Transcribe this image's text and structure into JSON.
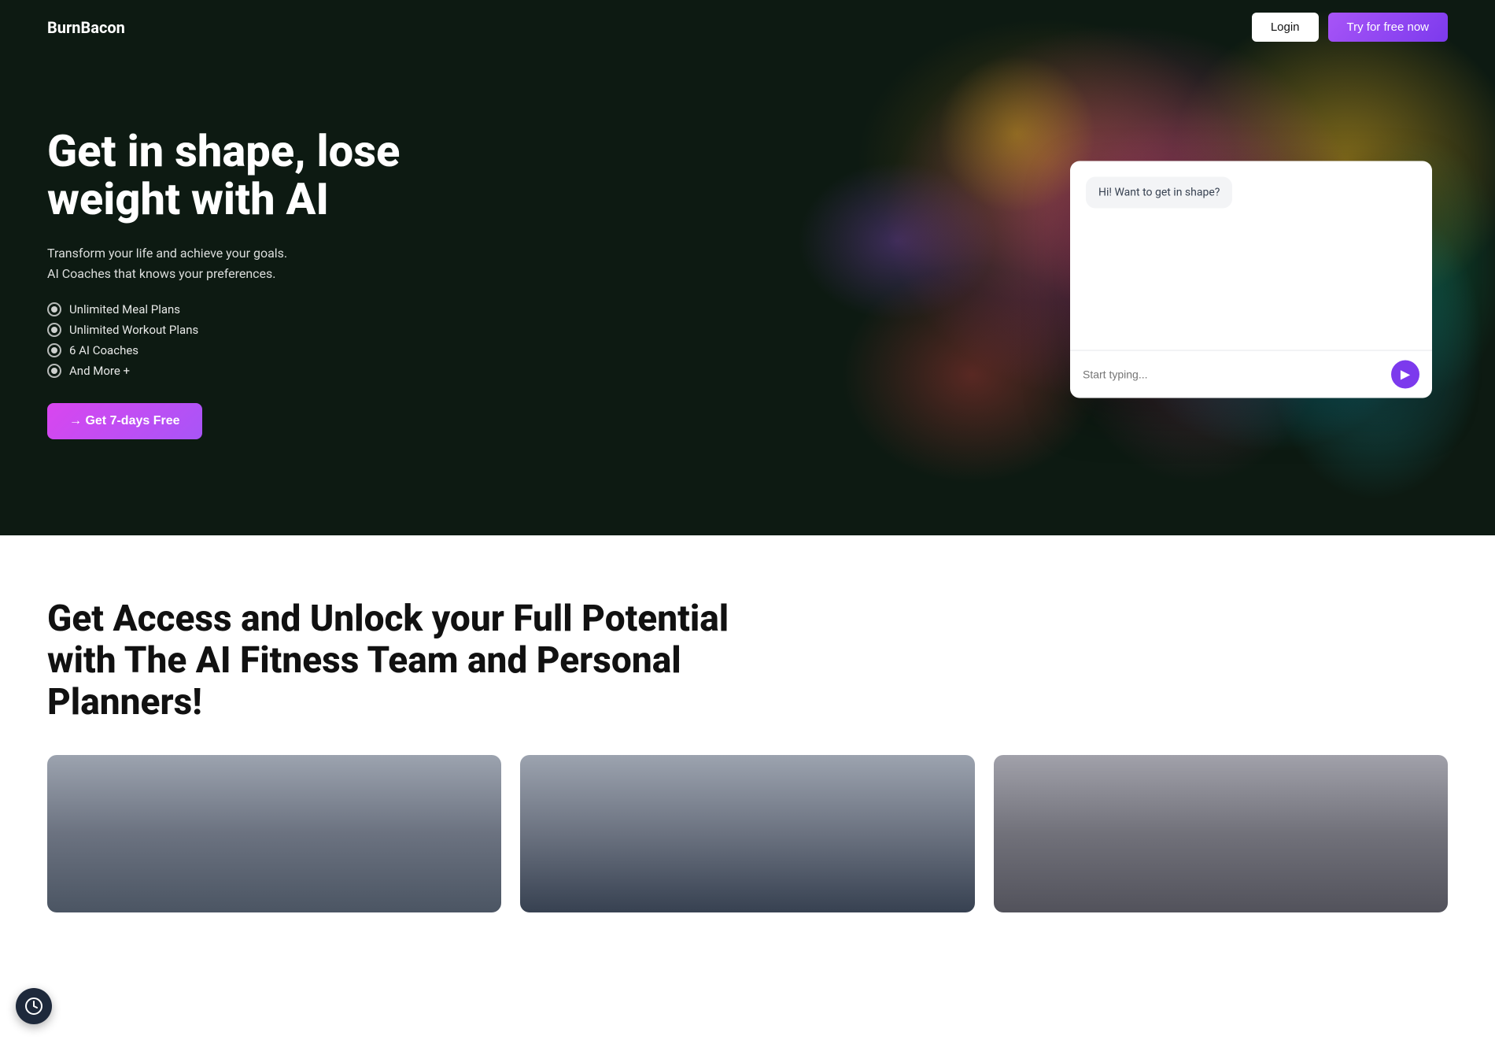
{
  "brand": {
    "name_part1": "Burn",
    "name_part2": "Bacon"
  },
  "navbar": {
    "login_label": "Login",
    "try_label": "Try for free now"
  },
  "hero": {
    "title": "Get in shape, lose weight with AI",
    "subtitle_line1": "Transform your life and achieve your goals.",
    "subtitle_line2": "AI Coaches that knows your preferences.",
    "features": [
      "Unlimited Meal Plans",
      "Unlimited Workout Plans",
      "6 AI Coaches",
      "And More +"
    ],
    "cta_label": "→ Get 7-days Free"
  },
  "chat": {
    "bubble_text": "Hi! Want to get in shape?",
    "input_placeholder": "Start typing..."
  },
  "section2": {
    "title": "Get Access and Unlock your Full Potential with The AI Fitness Team and Personal Planners!"
  },
  "icons": {
    "send_icon": "▶",
    "arrow_icon": "→",
    "widget_icon": "⏱"
  }
}
